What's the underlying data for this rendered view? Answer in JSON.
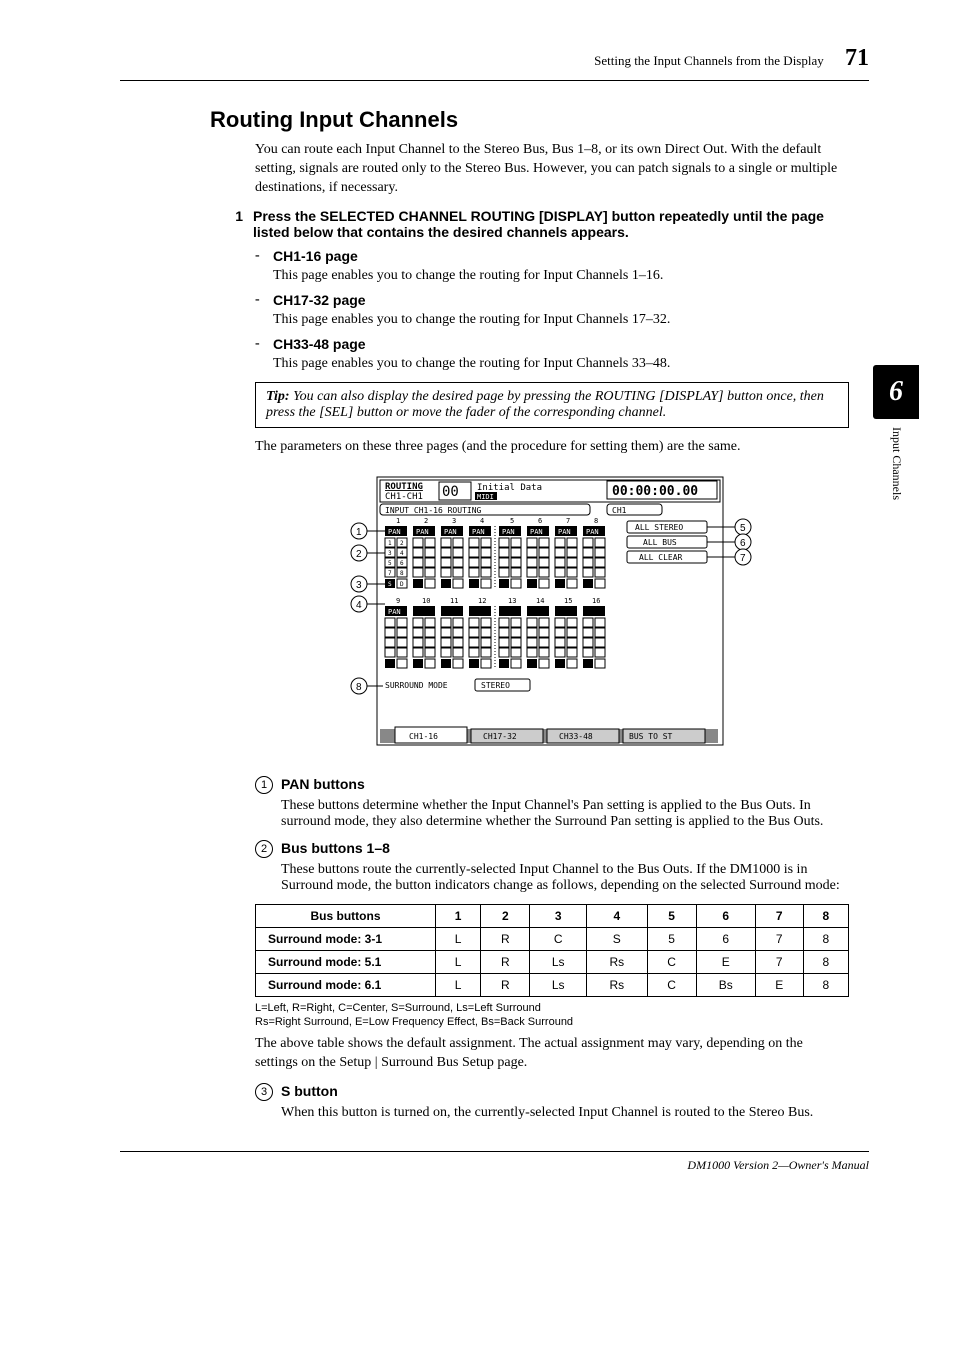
{
  "header": {
    "title": "Setting the Input Channels from the Display",
    "pagenum": "71"
  },
  "sidetab": {
    "chapter": "6",
    "label": "Input Channels"
  },
  "section_title": "Routing Input Channels",
  "intro": "You can route each Input Channel to the Stereo Bus, Bus 1–8, or its own Direct Out. With the default setting, signals are routed only to the Stereo Bus. However, you can patch signals to a single or multiple destinations, if necessary.",
  "step1": {
    "num": "1",
    "text": "Press the SELECTED CHANNEL ROUTING [DISPLAY] button repeatedly until the page listed below that contains the desired channels appears."
  },
  "sub": [
    {
      "title": "CH1-16 page",
      "desc": "This page enables you to change the routing for Input Channels 1–16."
    },
    {
      "title": "CH17-32 page",
      "desc": "This page enables you to change the routing for Input Channels 17–32."
    },
    {
      "title": "CH33-48 page",
      "desc": "This page enables you to change the routing for Input Channels 33–48."
    }
  ],
  "tip": {
    "label": "Tip:",
    "text": " You can also display the desired page by pressing the ROUTING [DISPLAY] button once, then press the [SEL] button or move the fader of the corresponding channel."
  },
  "postbox": "The parameters on these three pages (and the procedure for setting them) are the same.",
  "figure": {
    "top_left1": "ROUTING",
    "top_left2": "CH1-CH1",
    "top_center": "Initial Data",
    "top_right": "00:00:00.00",
    "subhead_left": "INPUT  CH1-16  ROUTING",
    "subhead_right": "CH1",
    "btn1": "ALL STEREO",
    "btn2": "ALL BUS",
    "btn3": "ALL CLEAR",
    "pan": "PAN",
    "s": "S",
    "d": "D",
    "surround_label": "SURROUND MODE",
    "surround_val": "STEREO",
    "tab1": "CH1-16",
    "tab2": "CH17-32",
    "tab3": "CH33-48",
    "tab4": "BUS TO ST",
    "scene": "00",
    "midi": "MIDI"
  },
  "callouts": [
    {
      "num": "1",
      "title": "PAN buttons",
      "desc": "These buttons determine whether the Input Channel's Pan setting is applied to the Bus Outs. In surround mode, they also determine whether the Surround Pan setting is applied to the Bus Outs."
    },
    {
      "num": "2",
      "title": "Bus buttons 1–8",
      "desc": "These buttons route the currently-selected Input Channel to the Bus Outs. If the DM1000 is in Surround mode, the button indicators change as follows, depending on the selected Surround mode:"
    },
    {
      "num": "3",
      "title": "S button",
      "desc": "When this button is turned on, the currently-selected Input Channel is routed to the Stereo Bus."
    }
  ],
  "table": {
    "head": [
      "Bus buttons",
      "1",
      "2",
      "3",
      "4",
      "5",
      "6",
      "7",
      "8"
    ],
    "rows": [
      {
        "label": "Surround mode: 3-1",
        "cells": [
          "L",
          "R",
          "C",
          "S",
          "5",
          "6",
          "7",
          "8"
        ]
      },
      {
        "label": "Surround mode: 5.1",
        "cells": [
          "L",
          "R",
          "Ls",
          "Rs",
          "C",
          "E",
          "7",
          "8"
        ]
      },
      {
        "label": "Surround mode: 6.1",
        "cells": [
          "L",
          "R",
          "Ls",
          "Rs",
          "C",
          "Bs",
          "E",
          "8"
        ]
      }
    ]
  },
  "legend": {
    "line1": "L=Left, R=Right, C=Center, S=Surround, Ls=Left Surround",
    "line2": "Rs=Right Surround, E=Low Frequency Effect, Bs=Back Surround"
  },
  "after_table": "The above table shows the default assignment. The actual assignment may vary, depending on the settings on the Setup | Surround Bus Setup page.",
  "footer": "DM1000 Version 2—Owner's Manual"
}
